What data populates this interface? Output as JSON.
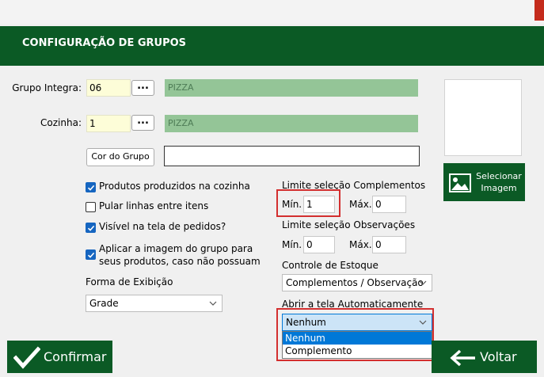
{
  "header": {
    "title": "CONFIGURAÇÃO DE GRUPOS"
  },
  "grupo_integra": {
    "label": "Grupo Integra:",
    "value": "06",
    "lookup_label": "...",
    "name": "PIZZA"
  },
  "cozinha": {
    "label": "Cozinha:",
    "value": "1",
    "lookup_label": "...",
    "name": "PIZZA"
  },
  "cor_grupo": {
    "button_label": "Cor do Grupo",
    "value": ""
  },
  "checkboxes": [
    {
      "label": "Produtos produzidos na cozinha",
      "checked": true
    },
    {
      "label": "Pular linhas entre itens",
      "checked": false
    },
    {
      "label": "Visível na tela de pedidos?",
      "checked": true
    },
    {
      "label": "Aplicar a imagem do grupo para seus produtos, caso não possuam",
      "label_line1": "Aplicar a imagem do grupo para",
      "label_line2": "seus produtos, caso não possuam",
      "checked": true
    }
  ],
  "forma_exibicao": {
    "label": "Forma de Exibição",
    "value": "Grade"
  },
  "limite_complementos": {
    "label": "Limite seleção Complementos",
    "min_label": "Mín.",
    "min_value": "1",
    "max_label": "Máx.",
    "max_value": "0"
  },
  "limite_observacoes": {
    "label": "Limite seleção Observações",
    "min_label": "Mín.",
    "min_value": "0",
    "max_label": "Máx.",
    "max_value": "0"
  },
  "controle_estoque": {
    "label": "Controle de Estoque",
    "value": "Complementos / Observação"
  },
  "abrir_tela": {
    "label": "Abrir a tela Automaticamente",
    "value": "Nenhum",
    "options": [
      "Nenhum",
      "Complemento"
    ]
  },
  "selecionar_imagem": {
    "line1": "Selecionar",
    "line2": "Imagem"
  },
  "footer": {
    "confirm_label": "Confirmar",
    "back_label": "Voltar"
  },
  "colors": {
    "header_green": "#0b5a25",
    "field_green": "#94c597",
    "field_yellow": "#fdfdd8",
    "highlight_red": "#d32f2f",
    "checkbox_blue": "#1565c0",
    "selection_blue": "#0078d7"
  }
}
